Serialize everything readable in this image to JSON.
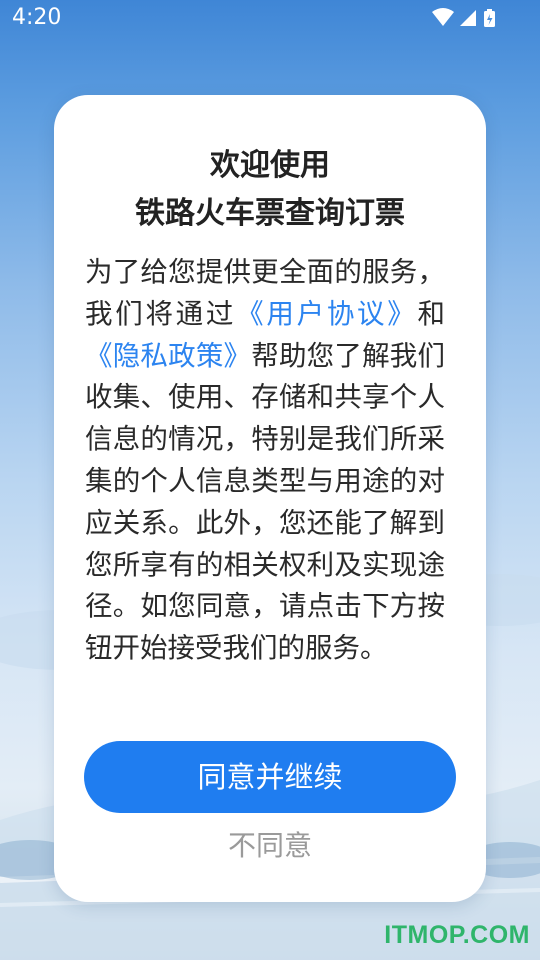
{
  "status_bar": {
    "time": "4:20",
    "icons": [
      "wifi-icon",
      "cellular-signal-icon",
      "battery-charging-icon"
    ]
  },
  "dialog": {
    "title_line1": "欢迎使用",
    "title_line2": "铁路火车票查询订票",
    "body": {
      "text_before_link1": "为了给您提供更全面的服务，我们将通过",
      "link_user_agreement": "《用户协议》",
      "text_and": "和",
      "link_privacy_policy": "《隐私政策》",
      "text_after": "帮助您了解我们收集、使用、存储和共享个人信息的情况，特别是我们所采集的个人信息类型与用途的对应关系。此外，您还能了解到您所享有的相关权利及实现途径。如您同意，请点击下方按钮开始接受我们的服务。"
    },
    "agree_button_label": "同意并继续",
    "disagree_button_label": "不同意"
  },
  "watermark": "ITMOP.COM",
  "colors": {
    "link": "#2c84f0",
    "primary_button": "#1f7df0",
    "watermark": "#2fb56b"
  }
}
